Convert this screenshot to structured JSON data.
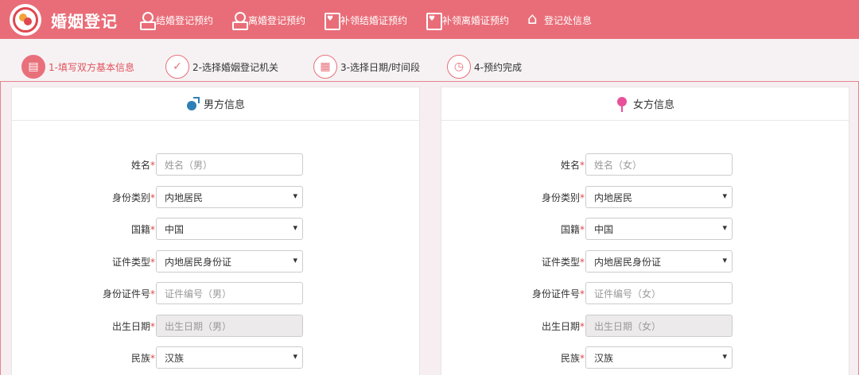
{
  "header": {
    "brand": "婚姻登记",
    "nav": [
      {
        "label": "结婚登记预约",
        "icon": "person-stamp-icon"
      },
      {
        "label": "离婚登记预约",
        "icon": "person-stamp-icon"
      },
      {
        "label": "补领结婚证预约",
        "icon": "certificate-icon"
      },
      {
        "label": "补领离婚证预约",
        "icon": "certificate-icon"
      },
      {
        "label": "登记处信息",
        "icon": "house-icon"
      }
    ]
  },
  "steps": [
    {
      "label": "1-填写双方基本信息",
      "active": true
    },
    {
      "label": "2-选择婚姻登记机关",
      "active": false
    },
    {
      "label": "3-选择日期/时间段",
      "active": false
    },
    {
      "label": "4-预约完成",
      "active": false
    }
  ],
  "male": {
    "title": "男方信息",
    "name_label": "姓名",
    "name_placeholder": "姓名（男）",
    "idtype_label": "身份类别",
    "idtype_value": "内地居民",
    "nationality_label": "国籍",
    "nationality_value": "中国",
    "doctype_label": "证件类型",
    "doctype_value": "内地居民身份证",
    "idno_label": "身份证件号",
    "idno_placeholder": "证件编号（男）",
    "birth_label": "出生日期",
    "birth_placeholder": "出生日期（男）",
    "ethnic_label": "民族",
    "ethnic_value": "汉族"
  },
  "female": {
    "title": "女方信息",
    "name_label": "姓名",
    "name_placeholder": "姓名（女）",
    "idtype_label": "身份类别",
    "idtype_value": "内地居民",
    "nationality_label": "国籍",
    "nationality_value": "中国",
    "doctype_label": "证件类型",
    "doctype_value": "内地居民身份证",
    "idno_label": "身份证件号",
    "idno_placeholder": "证件编号（女）",
    "birth_label": "出生日期",
    "birth_placeholder": "出生日期（女）",
    "ethnic_label": "民族",
    "ethnic_value": "汉族"
  },
  "required_mark": "*",
  "colors": {
    "nav_bg": "#e96d78",
    "accent": "#e0525d",
    "required": "#e0474f"
  }
}
